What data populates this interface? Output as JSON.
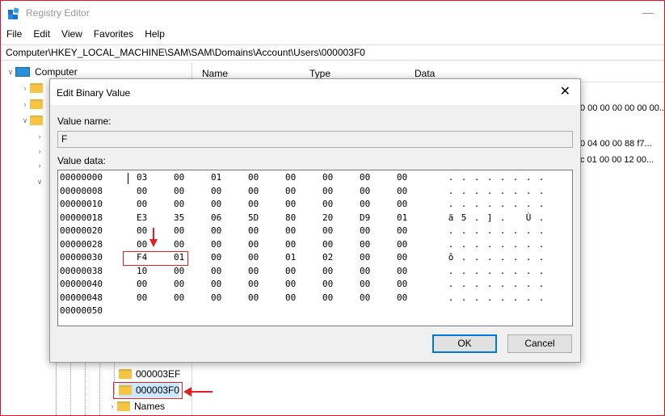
{
  "window": {
    "title": "Registry Editor",
    "minimize": "—"
  },
  "menu": [
    "File",
    "Edit",
    "View",
    "Favorites",
    "Help"
  ],
  "address": "Computer\\HKEY_LOCAL_MACHINE\\SAM\\SAM\\Domains\\Account\\Users\\000003F0",
  "tree": {
    "root": "Computer",
    "items": [
      "000003EF",
      "000003F0",
      "Names"
    ]
  },
  "list": {
    "columns": [
      "Name",
      "Type",
      "Data"
    ],
    "data_fragments": [
      "0 00 00 00 00 00 00...",
      "0 04 00 00 88 f7...",
      "c 01 00 00 12 00..."
    ]
  },
  "dialog": {
    "title": "Edit Binary Value",
    "close": "✕",
    "value_name_label": "Value name:",
    "value_name": "F",
    "value_data_label": "Value data:",
    "ok": "OK",
    "cancel": "Cancel",
    "rows": [
      {
        "addr": "00000000",
        "bytes": [
          "03",
          "00",
          "01",
          "00",
          "00",
          "00",
          "00",
          "00"
        ],
        "ascii": [
          ".",
          ".",
          ".",
          ".",
          ".",
          ".",
          ".",
          "."
        ]
      },
      {
        "addr": "00000008",
        "bytes": [
          "00",
          "00",
          "00",
          "00",
          "00",
          "00",
          "00",
          "00"
        ],
        "ascii": [
          ".",
          ".",
          ".",
          ".",
          ".",
          ".",
          ".",
          "."
        ]
      },
      {
        "addr": "00000010",
        "bytes": [
          "00",
          "00",
          "00",
          "00",
          "00",
          "00",
          "00",
          "00"
        ],
        "ascii": [
          ".",
          ".",
          ".",
          ".",
          ".",
          ".",
          ".",
          "."
        ]
      },
      {
        "addr": "00000018",
        "bytes": [
          "E3",
          "35",
          "06",
          "5D",
          "80",
          "20",
          "D9",
          "01"
        ],
        "ascii": [
          "ã",
          "5",
          ".",
          "]",
          ".",
          "",
          "Ù",
          "."
        ]
      },
      {
        "addr": "00000020",
        "bytes": [
          "00",
          "00",
          "00",
          "00",
          "00",
          "00",
          "00",
          "00"
        ],
        "ascii": [
          ".",
          ".",
          ".",
          ".",
          ".",
          ".",
          ".",
          "."
        ]
      },
      {
        "addr": "00000028",
        "bytes": [
          "00",
          "00",
          "00",
          "00",
          "00",
          "00",
          "00",
          "00"
        ],
        "ascii": [
          ".",
          ".",
          ".",
          ".",
          ".",
          ".",
          ".",
          "."
        ]
      },
      {
        "addr": "00000030",
        "bytes": [
          "F4",
          "01",
          "00",
          "00",
          "01",
          "02",
          "00",
          "00"
        ],
        "ascii": [
          "ô",
          ".",
          ".",
          ".",
          ".",
          ".",
          ".",
          "."
        ]
      },
      {
        "addr": "00000038",
        "bytes": [
          "10",
          "00",
          "00",
          "00",
          "00",
          "00",
          "00",
          "00"
        ],
        "ascii": [
          ".",
          ".",
          ".",
          ".",
          ".",
          ".",
          ".",
          "."
        ]
      },
      {
        "addr": "00000040",
        "bytes": [
          "00",
          "00",
          "00",
          "00",
          "00",
          "00",
          "00",
          "00"
        ],
        "ascii": [
          ".",
          ".",
          ".",
          ".",
          ".",
          ".",
          ".",
          "."
        ]
      },
      {
        "addr": "00000048",
        "bytes": [
          "00",
          "00",
          "00",
          "00",
          "00",
          "00",
          "00",
          "00"
        ],
        "ascii": [
          ".",
          ".",
          ".",
          ".",
          ".",
          ".",
          ".",
          "."
        ]
      },
      {
        "addr": "00000050",
        "bytes": [],
        "ascii": []
      }
    ]
  },
  "colors": {
    "annotation_red": "#e02020",
    "ok_focus": "#0078d7"
  }
}
